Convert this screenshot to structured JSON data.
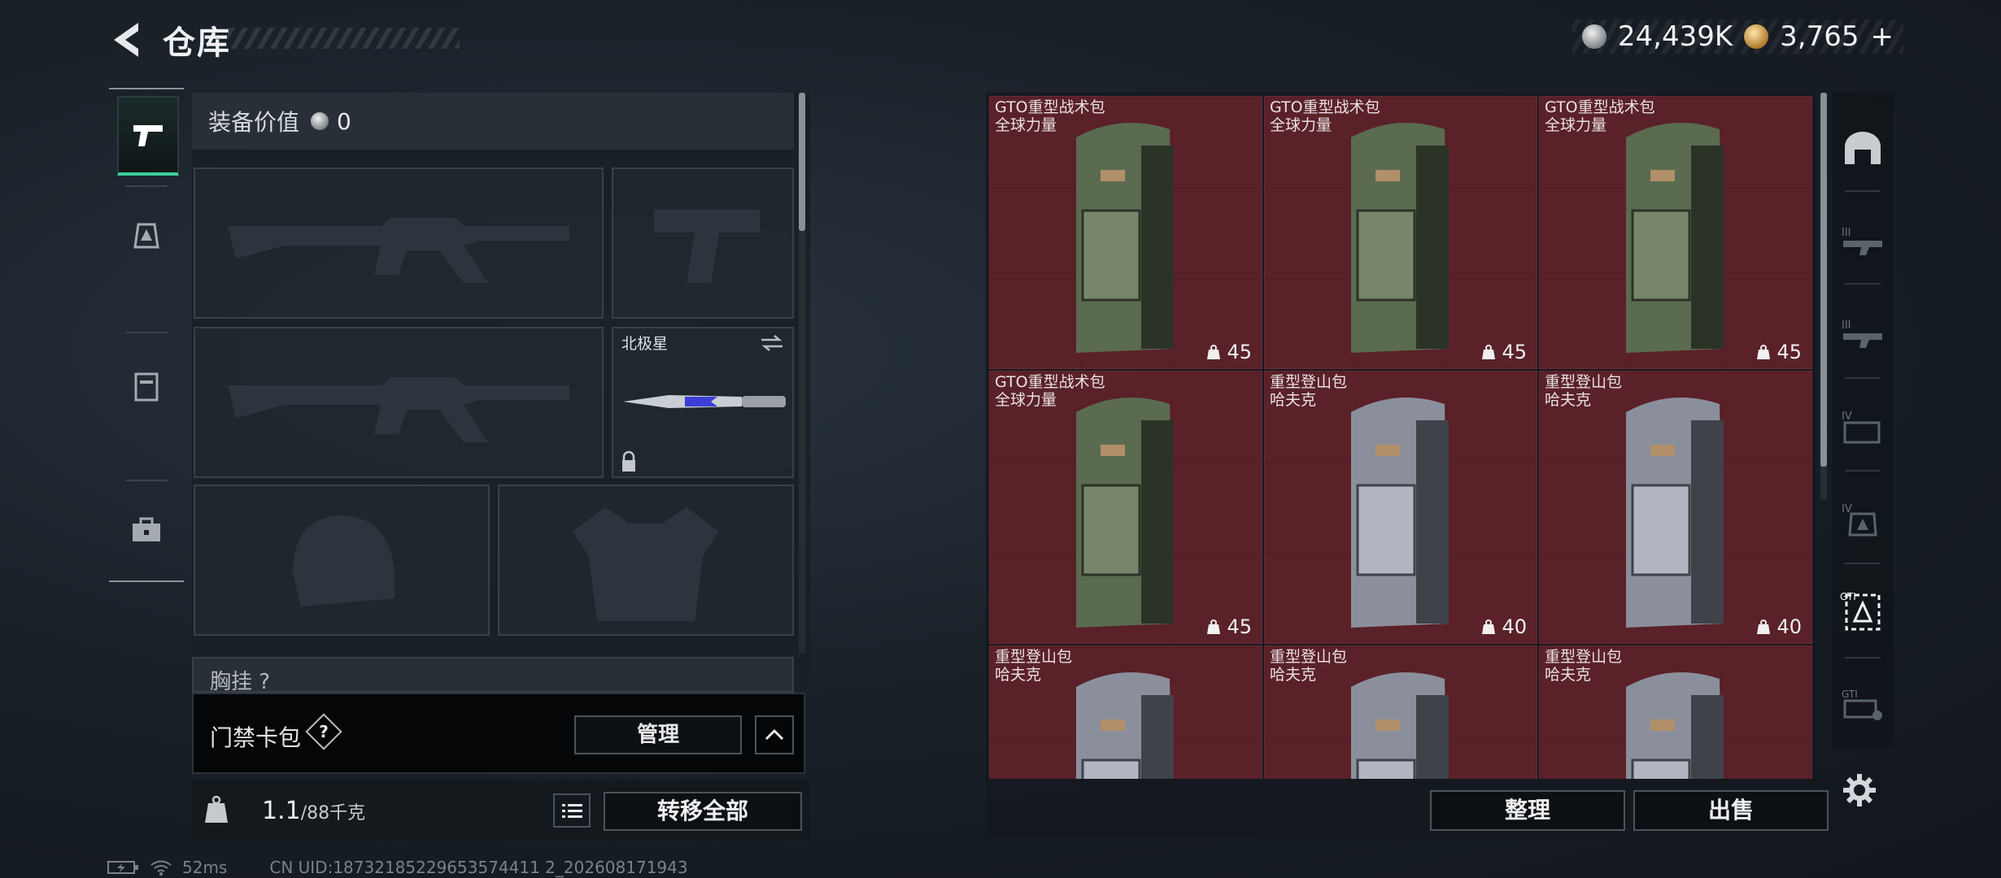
{
  "header": {
    "title": "仓库",
    "currencies": [
      {
        "icon": "silver-coin-icon",
        "value": "24,439K"
      },
      {
        "icon": "gold-coin-icon",
        "value": "3,765"
      }
    ],
    "add_label": "+"
  },
  "left_tabs": [
    {
      "icon": "pistol-icon",
      "active": true
    },
    {
      "icon": "backpack-emblem-icon",
      "active": false
    },
    {
      "icon": "locker-icon",
      "active": false
    },
    {
      "icon": "toolbox-icon",
      "active": false
    }
  ],
  "equipment": {
    "value_label": "装备价值",
    "value": "0",
    "knife_name": "北极星",
    "chest_label": "胸挂 ?"
  },
  "keycard": {
    "label": "门禁卡包",
    "help": "?",
    "manage_label": "管理"
  },
  "capacity": {
    "current": "1.1",
    "max": "/88千克",
    "transfer_label": "转移全部"
  },
  "inventory": {
    "items": [
      {
        "name": "GTO重型战术包",
        "brand": "全球力量",
        "capacity": "45",
        "variant": "green"
      },
      {
        "name": "GTO重型战术包",
        "brand": "全球力量",
        "capacity": "45",
        "variant": "green"
      },
      {
        "name": "GTO重型战术包",
        "brand": "全球力量",
        "capacity": "45",
        "variant": "green"
      },
      {
        "name": "GTO重型战术包",
        "brand": "全球力量",
        "capacity": "45",
        "variant": "green"
      },
      {
        "name": "重型登山包",
        "brand": "哈夫克",
        "capacity": "40",
        "variant": "grey"
      },
      {
        "name": "重型登山包",
        "brand": "哈夫克",
        "capacity": "40",
        "variant": "grey"
      },
      {
        "name": "重型登山包",
        "brand": "哈夫克",
        "capacity": "",
        "variant": "grey"
      },
      {
        "name": "重型登山包",
        "brand": "哈夫克",
        "capacity": "",
        "variant": "grey"
      },
      {
        "name": "重型登山包",
        "brand": "哈夫克",
        "capacity": "",
        "variant": "grey"
      }
    ],
    "sort_label": "整理",
    "sell_label": "出售"
  },
  "right_rail": [
    "base-icon",
    "tier-3-weapon-icon",
    "tier-3-weapon-icon",
    "tier-4-case-icon",
    "tier-4-backpack-icon",
    "gti-backpack-icon",
    "gti-case-icon"
  ],
  "status": {
    "ping": "52ms",
    "uid": "CN UID:18732185229653574411 2_202608171943"
  },
  "colors": {
    "slot_bg": "#5a2129",
    "accent": "#3ecf9a"
  }
}
